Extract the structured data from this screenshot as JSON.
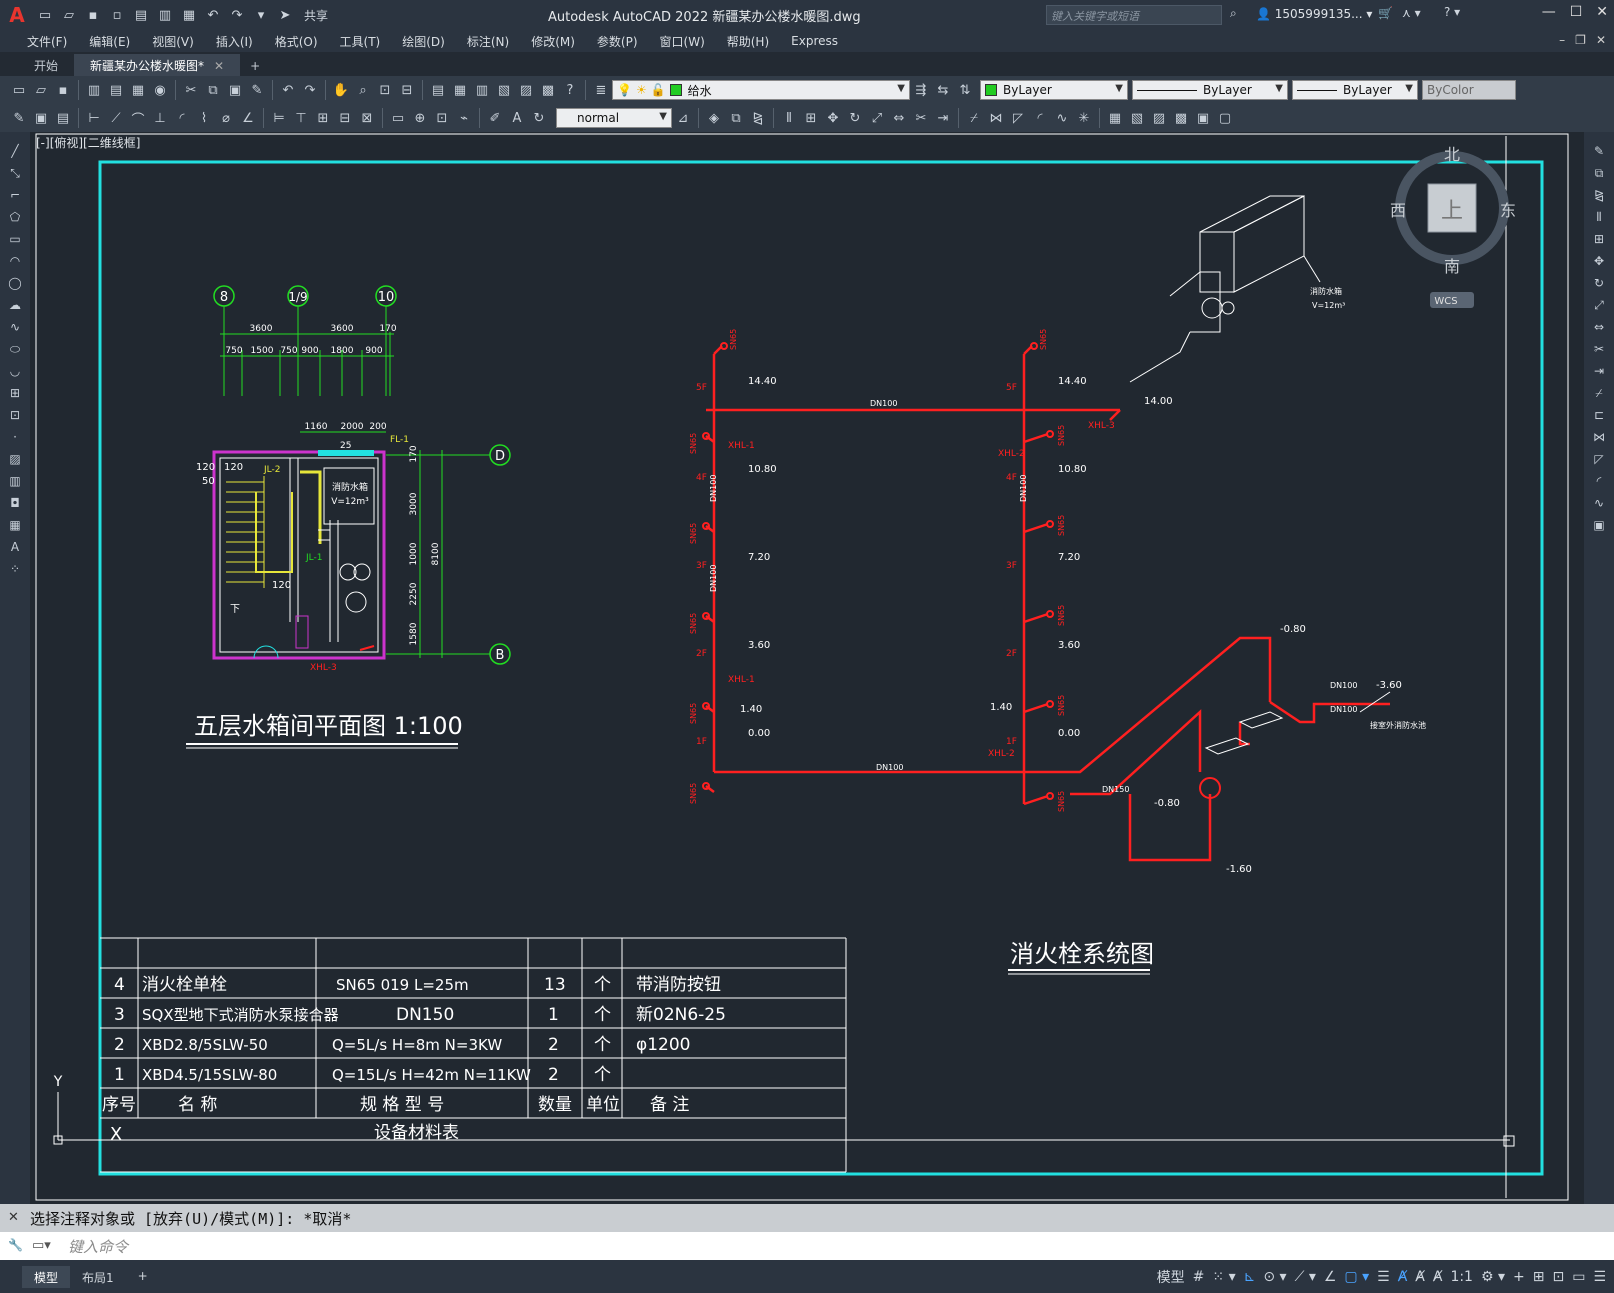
{
  "app": {
    "title": "Autodesk AutoCAD 2022    新疆某办公楼水暖图.dwg",
    "search_placeholder": "键入关键字或短语",
    "user": "1505999135...",
    "share": "共享"
  },
  "menu": [
    "文件(F)",
    "编辑(E)",
    "视图(V)",
    "插入(I)",
    "格式(O)",
    "工具(T)",
    "绘图(D)",
    "标注(N)",
    "修改(M)",
    "参数(P)",
    "窗口(W)",
    "帮助(H)",
    "Express"
  ],
  "tabs": [
    {
      "label": "开始"
    },
    {
      "label": "新疆某办公楼水暖图*"
    }
  ],
  "toolbar": {
    "layer": "给水",
    "layer_color": "#22cc22",
    "color": "ByLayer",
    "linetype": "ByLayer",
    "lineweight": "ByLayer",
    "plotstyle": "ByColor",
    "textstyle": "normal"
  },
  "viewport": {
    "label": "[-][俯视][二维线框]",
    "viewcube": {
      "north": "北",
      "south": "南",
      "east": "东",
      "west": "西",
      "top": "上",
      "wcs": "WCS"
    },
    "ucs_y": "Y",
    "ucs_x": "X"
  },
  "drawing": {
    "plan_title": "五层水箱间平面图 1:100",
    "system_title": "消火栓系统图",
    "axis_labels": [
      "8",
      "1/9",
      "10",
      "D",
      "B"
    ],
    "plan_dims_top": [
      "3600",
      "3600",
      "170"
    ],
    "plan_dims_sub": [
      "750",
      "1500",
      "750",
      "900",
      "1800",
      "900"
    ],
    "plan_dims_room": [
      "1160",
      "2000",
      "200"
    ],
    "plan_dims_right": [
      "170",
      "3000",
      "1000",
      "2250",
      "1580",
      "8100"
    ],
    "plan_misc": [
      "120",
      "120",
      "50",
      "25",
      "120",
      "下",
      "消防水箱",
      "V=12m³",
      "FL-1",
      "JL-2",
      "JL-1",
      "XHL-3"
    ],
    "elevations": [
      "14.40",
      "10.80",
      "7.20",
      "3.60",
      "1.40",
      "0.00",
      "14.00",
      "-0.80",
      "-0.80",
      "-1.60",
      "-3.60"
    ],
    "floors": [
      "5F",
      "4F",
      "3F",
      "2F",
      "1F"
    ],
    "pipes": [
      "DN100",
      "DN100",
      "DN100",
      "DN150",
      "DN100",
      "DN100",
      "DN100",
      "DN100"
    ],
    "hydrants": [
      "SN65"
    ],
    "system_labels": [
      "XHL-1",
      "XHL-2",
      "XHL-3",
      "消防水箱",
      "V=12m³",
      "接室外消防水池"
    ],
    "table": {
      "title": "设备材料表",
      "headers": [
        "序号",
        "名  称",
        "规 格 型 号",
        "数量",
        "单位",
        "备  注"
      ],
      "rows": [
        [
          "4",
          "消火栓单栓",
          "SN65     019     L=25m",
          "13",
          "个",
          "带消防按钮"
        ],
        [
          "3",
          "SQX型地下式消防水泵接合器",
          "DN150",
          "1",
          "个",
          "新02N6-25"
        ],
        [
          "2",
          "XBD2.8/5SLW-50",
          "Q=5L/s  H=8m  N=3KW",
          "2",
          "个",
          "φ1200"
        ],
        [
          "1",
          "XBD4.5/15SLW-80",
          "Q=15L/s  H=42m  N=11KW",
          "2",
          "个",
          ""
        ]
      ]
    }
  },
  "command": {
    "history": "选择注释对象或 [放弃(U)/模式(M)]: *取消*",
    "placeholder": "键入命令"
  },
  "status": {
    "tabs": [
      "模型",
      "布局1"
    ],
    "model_label": "模型",
    "scale": "1:1"
  }
}
